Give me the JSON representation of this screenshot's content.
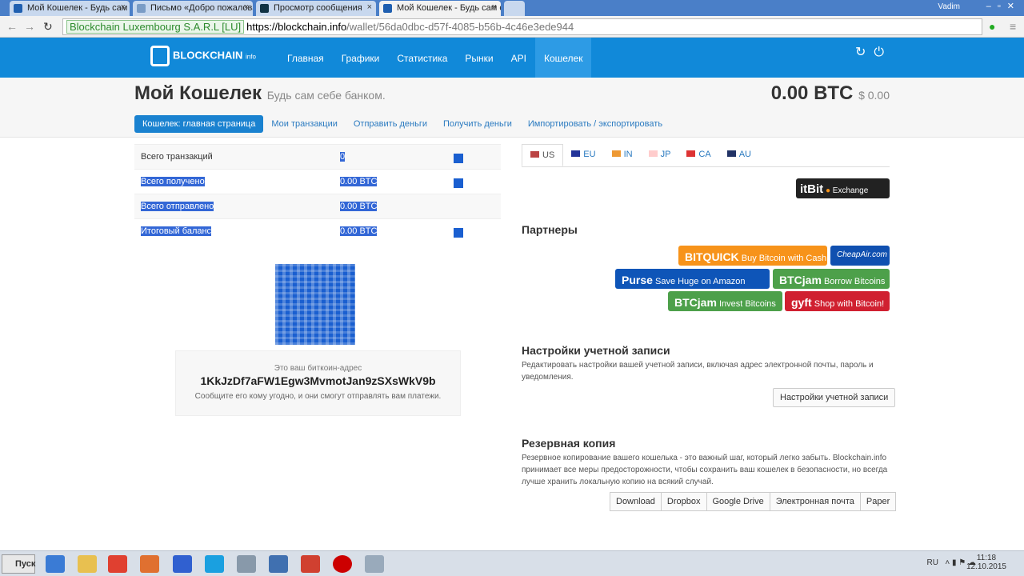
{
  "browser": {
    "tabs": [
      "Мой Кошелек - Будь сам се",
      "Письмо «Добро пожаловат",
      "Просмотр сообщения",
      "Мой Кошелек - Будь сам се"
    ],
    "user": "Vadim",
    "ev_label": "Blockchain Luxembourg S.A.R.L [LU]",
    "url_scheme": "https://",
    "url_domain": "blockchain.info",
    "url_path": "/wallet/56da0dbc-d57f-4085-b56b-4c46e3ede944"
  },
  "header": {
    "logo": "BLOCKCHAIN",
    "logo_sub": "info",
    "menu": [
      "Главная",
      "Графики",
      "Статистика",
      "Рынки",
      "API",
      "Кошелек"
    ]
  },
  "page": {
    "title": "Мой Кошелек",
    "subtitle": "Будь сам себе банком.",
    "balance_btc": "0.00 BTC",
    "balance_usd": "$ 0.00",
    "subnav": [
      "Кошелек: главная страница",
      "Мои транзакции",
      "Отправить деньги",
      "Получить деньги",
      "Импортировать / экспортировать"
    ]
  },
  "stats": [
    {
      "label": "Всего транзакций",
      "value": "0"
    },
    {
      "label": "Всего получено",
      "value": "0.00 BTC"
    },
    {
      "label": "Всего отправлено",
      "value": "0.00 BTC"
    },
    {
      "label": "Итоговый баланс",
      "value": "0.00 BTC"
    }
  ],
  "address": {
    "caption": "Это ваш биткоин-адрес",
    "value": "1KkJzDf7aFW1Egw3MvmotJan9zSXsWkV9b",
    "note": "Сообщите его кому угодно, и они смогут отправлять вам платежи."
  },
  "currency_tabs": [
    "US",
    "EU",
    "IN",
    "JP",
    "CA",
    "AU"
  ],
  "itbit": {
    "brand": "itBit",
    "label": "Exchange"
  },
  "partners": {
    "title": "Партнеры",
    "items": [
      {
        "brand": "BITQUICK",
        "text": "Buy Bitcoin with Cash"
      },
      {
        "brand": "CheapAir.com",
        "text": ""
      },
      {
        "brand": "Purse",
        "text": "Save Huge on Amazon"
      },
      {
        "brand": "BTCjam",
        "text": "Borrow Bitcoins"
      },
      {
        "brand": "BTCjam",
        "text": "Invest Bitcoins"
      },
      {
        "brand": "gyft",
        "text": "Shop with Bitcoin!"
      }
    ]
  },
  "account": {
    "title": "Настройки учетной записи",
    "desc": "Редактировать настройки вашей учетной записи, включая адрес электронной почты, пароль и уведомления.",
    "button": "Настройки учетной записи"
  },
  "backup": {
    "title": "Резервная копия",
    "desc": "Резервное копирование вашего кошелька - это важный шаг, который легко забыть. Blockchain.info принимает все меры предосторожности, чтобы сохранить ваш кошелек в безопасности, но всегда лучше хранить локальную копию на всякий случай.",
    "buttons": [
      "Download",
      "Dropbox",
      "Google Drive",
      "Электронная почта",
      "Paper"
    ]
  },
  "taskbar": {
    "start": "Пуск",
    "lang": "RU",
    "time": "11:18",
    "date": "12.10.2015"
  }
}
